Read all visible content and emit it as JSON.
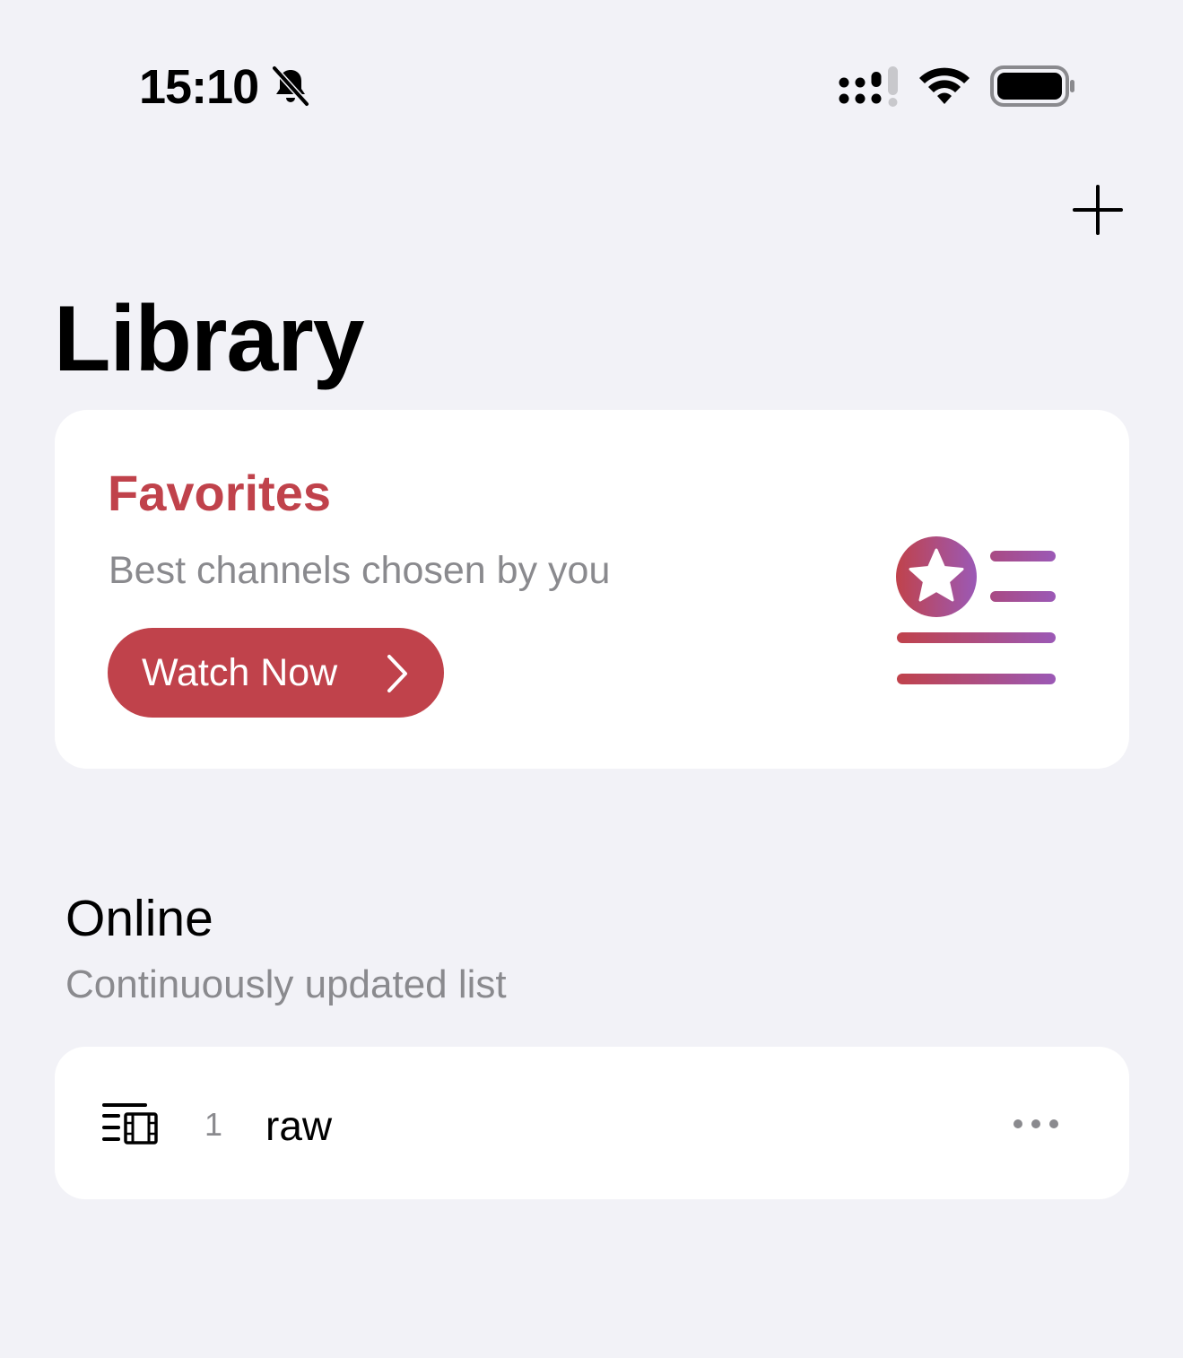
{
  "status_bar": {
    "time": "15:10",
    "icons": [
      "bell-slash-icon",
      "cellular-signal-icon",
      "wifi-icon",
      "battery-icon"
    ]
  },
  "header": {
    "add_icon": "plus-icon",
    "title": "Library"
  },
  "favorites_card": {
    "title": "Favorites",
    "subtitle": "Best channels chosen by you",
    "button_label": "Watch Now",
    "button_icon": "chevron-right-icon",
    "illustration_icon": "star-list-icon",
    "accent_color": "#c0424b",
    "gradient_end_color": "#9b59b6"
  },
  "online_section": {
    "title": "Online",
    "subtitle": "Continuously updated list",
    "items": [
      {
        "icon": "playlist-video-icon",
        "count": "1",
        "name": "raw",
        "more_icon": "ellipsis-icon"
      }
    ]
  },
  "colors": {
    "background": "#f2f2f7",
    "card": "#ffffff",
    "secondary_text": "#8a8a8e"
  }
}
